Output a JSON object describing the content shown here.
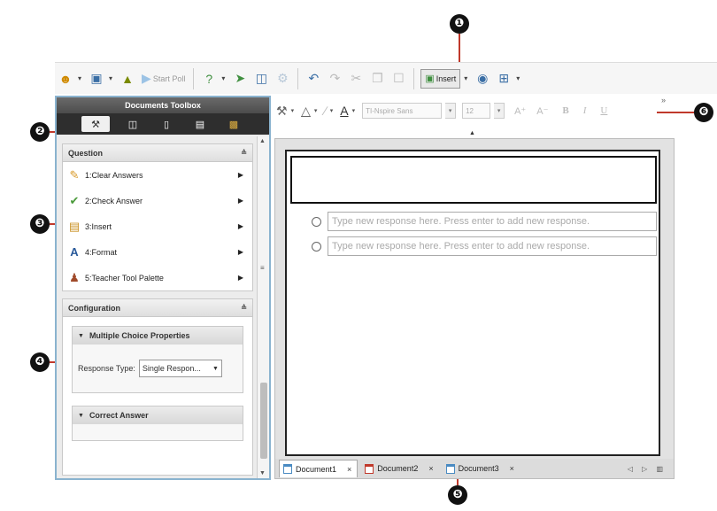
{
  "callouts": [
    "❶",
    "❷",
    "❸",
    "❹",
    "❺",
    "❻"
  ],
  "main_toolbar": {
    "start_poll_label": "Start Poll",
    "insert_label": "Insert",
    "icons": [
      "class-icon",
      "screen-capture-icon",
      "lock-icon",
      "start-poll-icon",
      "question-icon",
      "send-icon",
      "save-icon",
      "collect-icon",
      "review-icon",
      "undo-icon",
      "redo-icon",
      "cut-icon",
      "copy-icon",
      "paste-icon",
      "insert-icon",
      "calculator-icon",
      "layout-icon"
    ]
  },
  "documents_toolbox": {
    "title": "Documents Toolbox",
    "tabs": [
      "tools-tab",
      "page-sorter-tab",
      "ti-smartview-tab",
      "utilities-tab",
      "content-explorer-tab"
    ],
    "question_section": {
      "title": "Question",
      "items": [
        {
          "label": "1:Clear Answers",
          "icon": "clear-answers-icon"
        },
        {
          "label": "2:Check Answer",
          "icon": "check-answer-icon"
        },
        {
          "label": "3:Insert",
          "icon": "insert-icon"
        },
        {
          "label": "4:Format",
          "icon": "format-icon"
        },
        {
          "label": "5:Teacher Tool Palette",
          "icon": "teacher-tool-palette-icon"
        }
      ]
    },
    "configuration_section": {
      "title": "Configuration",
      "multiple_choice": {
        "title": "Multiple Choice Properties",
        "response_type_label": "Response Type:",
        "response_type_value": "Single Respon..."
      },
      "correct_answer": {
        "title": "Correct Answer"
      }
    }
  },
  "format_toolbar": {
    "font_name": "TI-Nspire Sans",
    "font_size": "12",
    "increase_font": "A⁺",
    "decrease_font": "A⁻",
    "bold": "B",
    "italic": "I",
    "underline": "U",
    "more": "»"
  },
  "document": {
    "response_placeholders": [
      "Type new response here. Press enter to add new response.",
      "Type new response here. Press enter to add new response."
    ]
  },
  "doc_tabs": [
    {
      "label": "Document1",
      "close": "×"
    },
    {
      "label": "Document2",
      "close": "×"
    },
    {
      "label": "Document3",
      "close": "×"
    }
  ],
  "tab_nav": "◁ ▷ ▥"
}
